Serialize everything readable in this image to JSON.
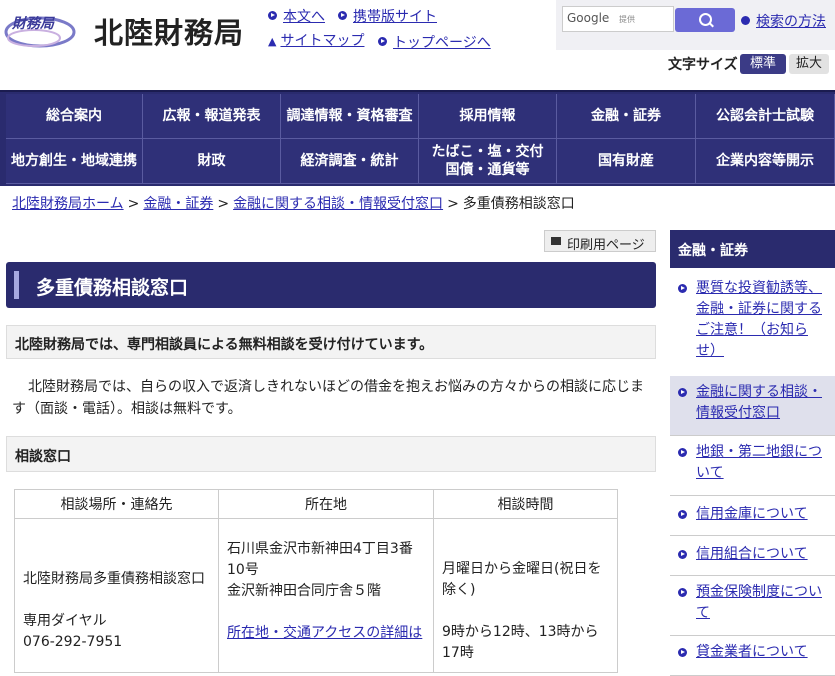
{
  "header": {
    "site_title": "北陸財務局",
    "logo_text": "財務局",
    "links": [
      "本文へ",
      "携帯版サイト",
      "サイトマップ",
      "トップページへ"
    ],
    "search": {
      "placeholder_brand": "Google",
      "placeholder_suffix": "提供",
      "help_label": "検索の方法"
    },
    "font_size": {
      "label": "文字サイズ",
      "standard": "標準",
      "large": "拡大"
    }
  },
  "nav": {
    "row1": [
      "総合案内",
      "広報・報道発表",
      "調達情報・資格審査",
      "採用情報",
      "金融・証券",
      "公認会計士試験"
    ],
    "row2": [
      "地方創生・地域連携",
      "財政",
      "経済調査・統計",
      "たばこ・塩・交付\n国債・通貨等",
      "国有財産",
      "企業内容等開示"
    ]
  },
  "breadcrumb": {
    "items": [
      "北陸財務局ホーム",
      "金融・証券",
      "金融に関する相談・情報受付窓口"
    ],
    "current": "多重債務相談窓口",
    "sep": ">"
  },
  "print_label": "印刷用ページ",
  "page": {
    "title": "多重債務相談窓口",
    "lead_heading": "北陸財務局では、専門相談員による無料相談を受け付けています。",
    "intro": "北陸財務局では、自らの収入で返済しきれないほどの借金を抱えお悩みの方々からの相談に応じます（面談・電話）。相談は無料です。",
    "section_heading": "相談窓口"
  },
  "table": {
    "headers": [
      "相談場所・連絡先",
      "所在地",
      "相談時間"
    ],
    "row": {
      "place_name": "北陸財務局多重債務相談窓口",
      "dial_label": "専用ダイヤル",
      "dial_number": "076-292-7951",
      "address_line1": "石川県金沢市新神田4丁目3番10号",
      "address_line2": "金沢新神田合同庁舎５階",
      "access_link": "所在地・交通アクセスの詳細は",
      "hours_days": "月曜日から金曜日(祝日を除く)",
      "hours_time": "9時から12時、13時から17時"
    }
  },
  "sidebar": {
    "heading": "金融・証券",
    "items": [
      "悪質な投資勧誘等、金融・証券に関するご注意！（お知らせ）",
      "金融に関する相談・情報受付窓口",
      "地銀・第二地銀について",
      "信用金庫について",
      "信用組合について",
      "預金保険制度について",
      "貸金業者について"
    ]
  },
  "colors": {
    "nav_bg": "#2a2b6e",
    "link": "#2b2bb0",
    "accent_button": "#6b6ad6"
  }
}
